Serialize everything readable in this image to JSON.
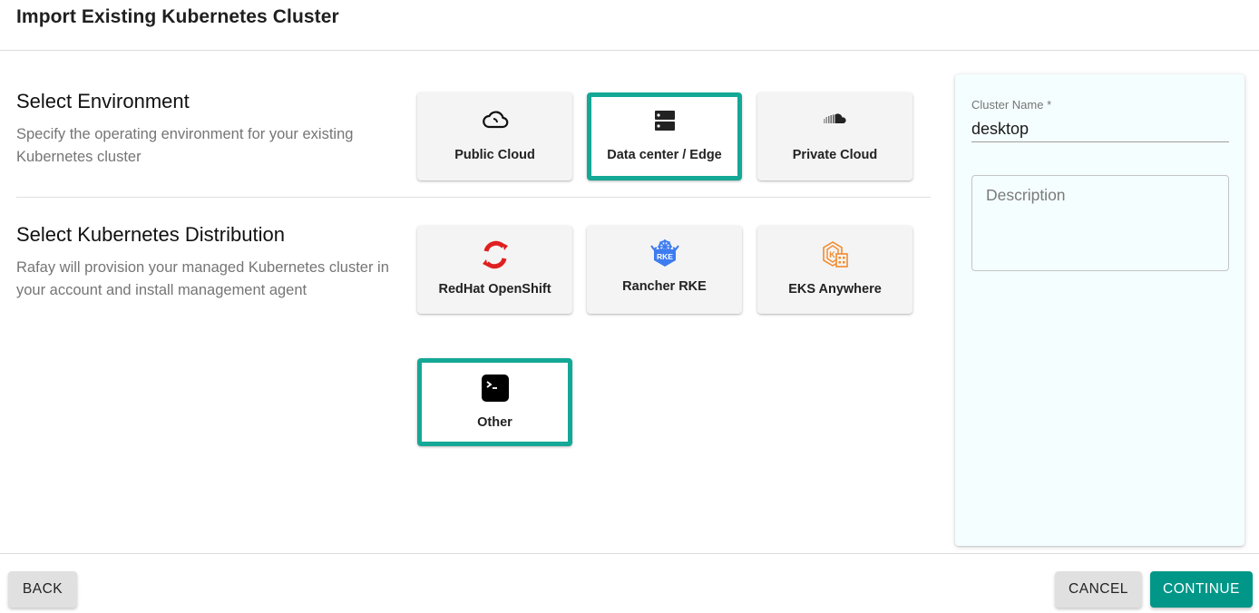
{
  "header": {
    "title": "Import Existing Kubernetes Cluster"
  },
  "environment": {
    "title": "Select Environment",
    "description": "Specify the operating environment for your existing Kubernetes cluster",
    "options": [
      {
        "label": "Public Cloud",
        "icon": "cloud-outline-icon",
        "selected": false
      },
      {
        "label": "Data center / Edge",
        "icon": "server-icon",
        "selected": true
      },
      {
        "label": "Private Cloud",
        "icon": "soundcloud-icon",
        "selected": false
      }
    ]
  },
  "distribution": {
    "title": "Select Kubernetes Distribution",
    "description": "Rafay will provision your managed Kubernetes cluster in your account and install management agent",
    "options": [
      {
        "label": "RedHat OpenShift",
        "icon": "openshift-logo-icon",
        "selected": false
      },
      {
        "label": "Rancher RKE",
        "icon": "rancher-rke-logo-icon",
        "selected": false
      },
      {
        "label": "EKS Anywhere",
        "icon": "eks-anywhere-logo-icon",
        "selected": false
      },
      {
        "label": "Other",
        "icon": "terminal-icon",
        "selected": true
      }
    ]
  },
  "form": {
    "cluster_name_label": "Cluster Name *",
    "cluster_name_value": "desktop",
    "description_placeholder": "Description",
    "description_value": ""
  },
  "footer": {
    "back_label": "BACK",
    "cancel_label": "CANCEL",
    "continue_label": "CONTINUE"
  },
  "colors": {
    "accent": "#14a896",
    "primary_button": "#009688",
    "side_panel_bg": "#f5feff",
    "openshift_red": "#e02020",
    "rancher_blue": "#3d7cf0",
    "eks_orange": "#f28b2d"
  }
}
